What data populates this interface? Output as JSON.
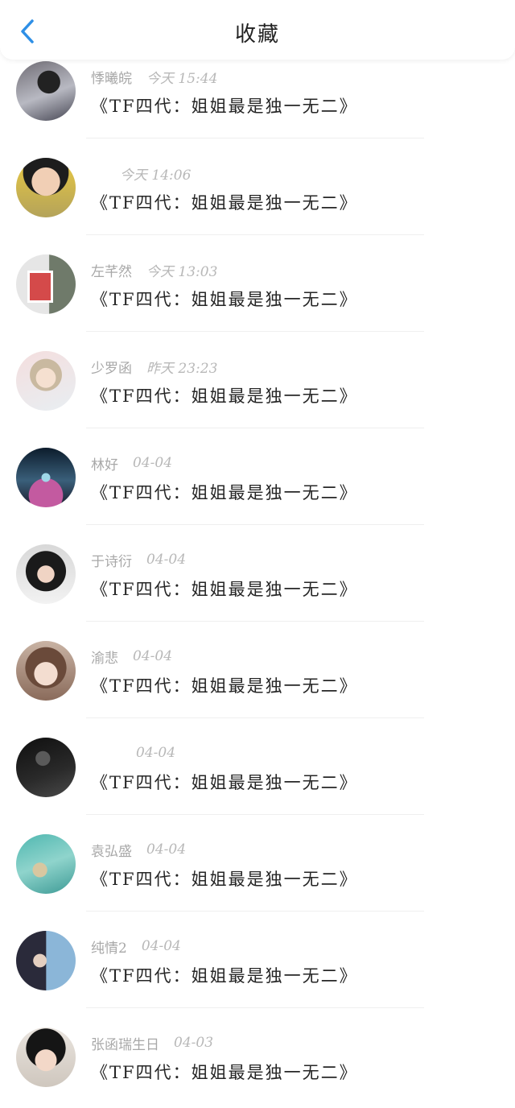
{
  "header": {
    "title": "收藏",
    "back_icon": "chevron-left-icon",
    "accent": "#2e8fe6"
  },
  "items": [
    {
      "name": "悸曦皖",
      "time": "今天 15:44",
      "message": "《TF四代：姐姐最是独一无二》"
    },
    {
      "name": "",
      "time": "今天 14:06",
      "message": "《TF四代：姐姐最是独一无二》"
    },
    {
      "name": "左芊然",
      "time": "今天 13:03",
      "message": "《TF四代：姐姐最是独一无二》"
    },
    {
      "name": "少罗函",
      "time": "昨天 23:23",
      "message": "《TF四代：姐姐最是独一无二》"
    },
    {
      "name": "林好",
      "time": "04-04",
      "message": "《TF四代：姐姐最是独一无二》"
    },
    {
      "name": "于诗衍",
      "time": "04-04",
      "message": "《TF四代：姐姐最是独一无二》"
    },
    {
      "name": "渝悲",
      "time": "04-04",
      "message": "《TF四代：姐姐最是独一无二》"
    },
    {
      "name": "",
      "time": "04-04",
      "message": "《TF四代：姐姐最是独一无二》"
    },
    {
      "name": "袁弘盛",
      "time": "04-04",
      "message": "《TF四代：姐姐最是独一无二》"
    },
    {
      "name": "纯情2",
      "time": "04-04",
      "message": "《TF四代：姐姐最是独一无二》"
    },
    {
      "name": "张函瑞生日",
      "time": "04-03",
      "message": "《TF四代：姐姐最是独一无二》"
    }
  ]
}
